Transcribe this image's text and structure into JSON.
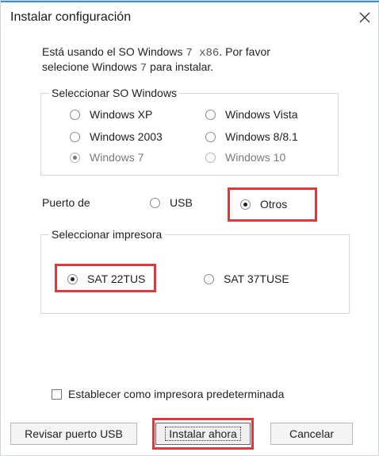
{
  "window": {
    "title": "Instalar configuración",
    "close_icon": "close-icon"
  },
  "message": {
    "line1_prefix": "Está usando el SO Windows",
    "line1_os": "7 x86",
    "line1_suffix": ". Por favor",
    "line2_prefix": "selecione Windows",
    "line2_os": "7",
    "line2_suffix": "para instalar."
  },
  "os_group": {
    "label": "Seleccionar SO Windows",
    "options": [
      {
        "label": "Windows XP",
        "checked": false
      },
      {
        "label": "Windows Vista",
        "checked": false
      },
      {
        "label": "Windows 2003",
        "checked": false
      },
      {
        "label": "Windows 8/8.1",
        "checked": false
      },
      {
        "label": "Windows 7",
        "checked": true
      },
      {
        "label": "Windows 10",
        "checked": false
      }
    ]
  },
  "port": {
    "label": "Puerto de",
    "options": [
      {
        "label": "USB",
        "checked": false
      },
      {
        "label": "Otros",
        "checked": true
      }
    ]
  },
  "printer_group": {
    "label": "Seleccionar impresora",
    "options": [
      {
        "label": "SAT 22TUS",
        "checked": true
      },
      {
        "label": "SAT 37TUSE",
        "checked": false
      }
    ]
  },
  "default_printer": {
    "label": "Establecer como impresora predeterminada",
    "checked": false
  },
  "buttons": {
    "check_usb": "Revisar puerto USB",
    "install": "Instalar ahora",
    "cancel": "Cancelar"
  },
  "colors": {
    "highlight": "#d93a3a",
    "accent_top": "#3a8fd6"
  }
}
